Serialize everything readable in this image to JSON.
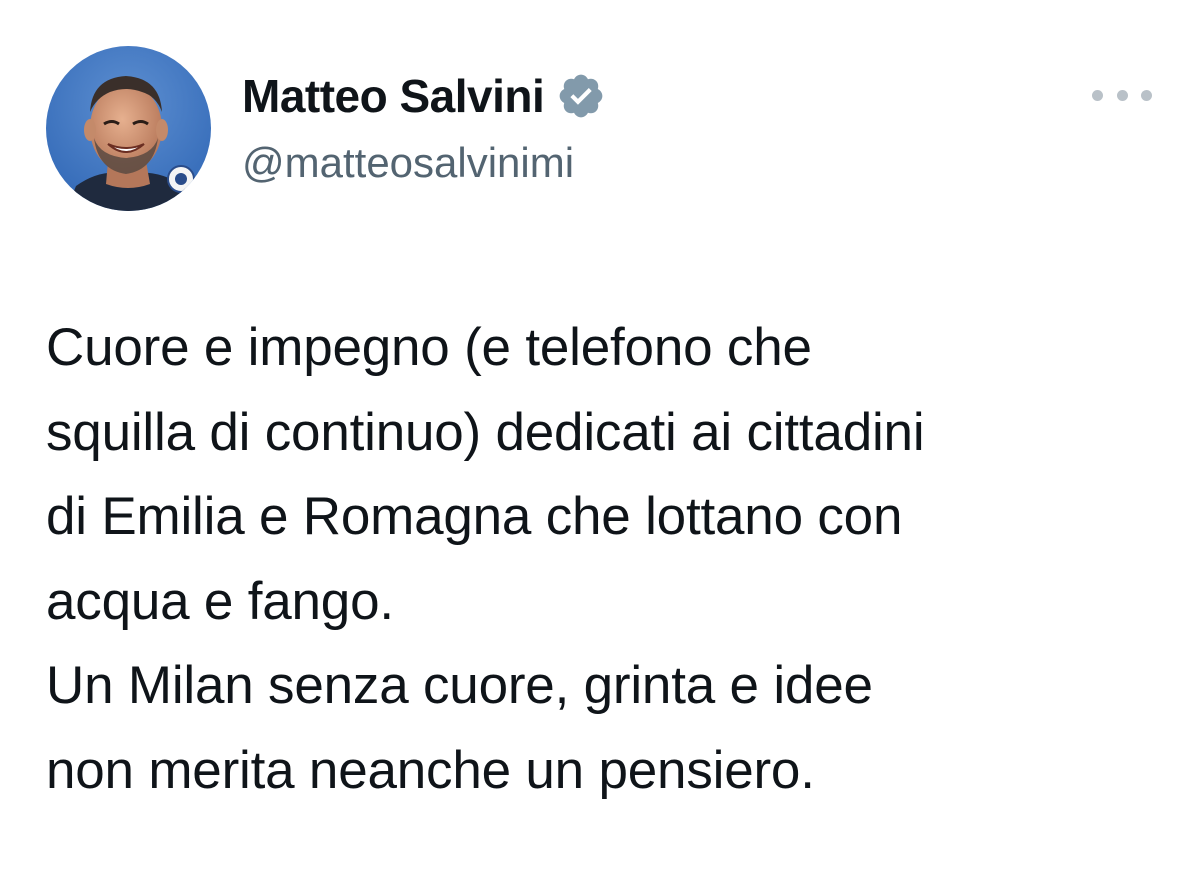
{
  "author": {
    "display_name": "Matteo Salvini",
    "handle": "@matteosalvinimi",
    "verified": true,
    "badge_color": "#829aab",
    "avatar_icon": "profile-photo"
  },
  "more_menu_icon": "more-horizontal-icon",
  "tweet": {
    "lines": [
      "Cuore e impegno (e telefono che",
      "squilla di continuo) dedicati ai cittadini",
      "di Emilia e Romagna che lottano con",
      "acqua e fango.",
      "Un Milan senza cuore, grinta e idee",
      "non merita neanche un pensiero."
    ]
  },
  "colors": {
    "text_primary": "#0f1419",
    "text_secondary": "#536471",
    "menu_dots": "#b9c1c8",
    "background": "#ffffff"
  }
}
